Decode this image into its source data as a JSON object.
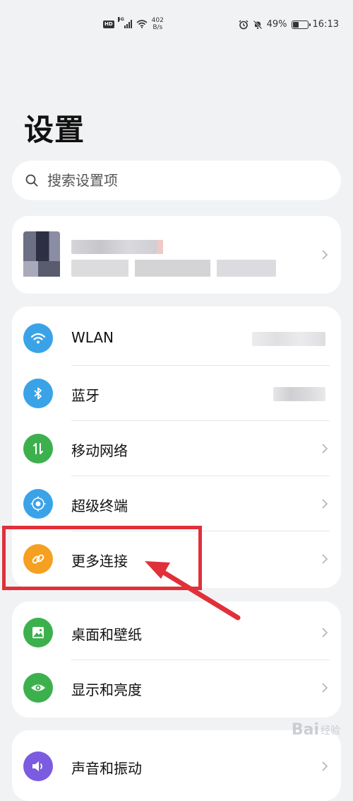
{
  "status_bar": {
    "hd_badge": "HD",
    "signal_label": "5G",
    "net_speed_value": "402",
    "net_speed_unit": "B/s",
    "battery_percent": "49%",
    "battery_level": 0.49,
    "time": "16:13"
  },
  "page": {
    "title": "设置"
  },
  "search": {
    "placeholder": "搜索设置项"
  },
  "groups": [
    {
      "items": [
        {
          "id": "wlan",
          "label": "WLAN",
          "icon": "wifi-icon",
          "color": "#3aa3e8"
        },
        {
          "id": "bluetooth",
          "label": "蓝牙",
          "icon": "bluetooth-icon",
          "color": "#3aa3e8"
        },
        {
          "id": "mobile",
          "label": "移动网络",
          "icon": "mobile-data-icon",
          "color": "#3db04e"
        },
        {
          "id": "super-device",
          "label": "超级终端",
          "icon": "super-device-icon",
          "color": "#3aa3e8"
        },
        {
          "id": "more-connections",
          "label": "更多连接",
          "icon": "link-icon",
          "color": "#f5a020"
        }
      ]
    },
    {
      "items": [
        {
          "id": "wallpaper",
          "label": "桌面和壁纸",
          "icon": "image-icon",
          "color": "#3db04e"
        },
        {
          "id": "display",
          "label": "显示和亮度",
          "icon": "eye-icon",
          "color": "#3db04e"
        }
      ]
    },
    {
      "items": [
        {
          "id": "sound",
          "label": "声音和振动",
          "icon": "speaker-icon",
          "color": "#7b5ce0"
        }
      ]
    }
  ],
  "colors": {
    "highlight": "#e0303a",
    "background": "#f1f2f4"
  },
  "watermark": {
    "text": "Bai",
    "text2": "经验"
  }
}
